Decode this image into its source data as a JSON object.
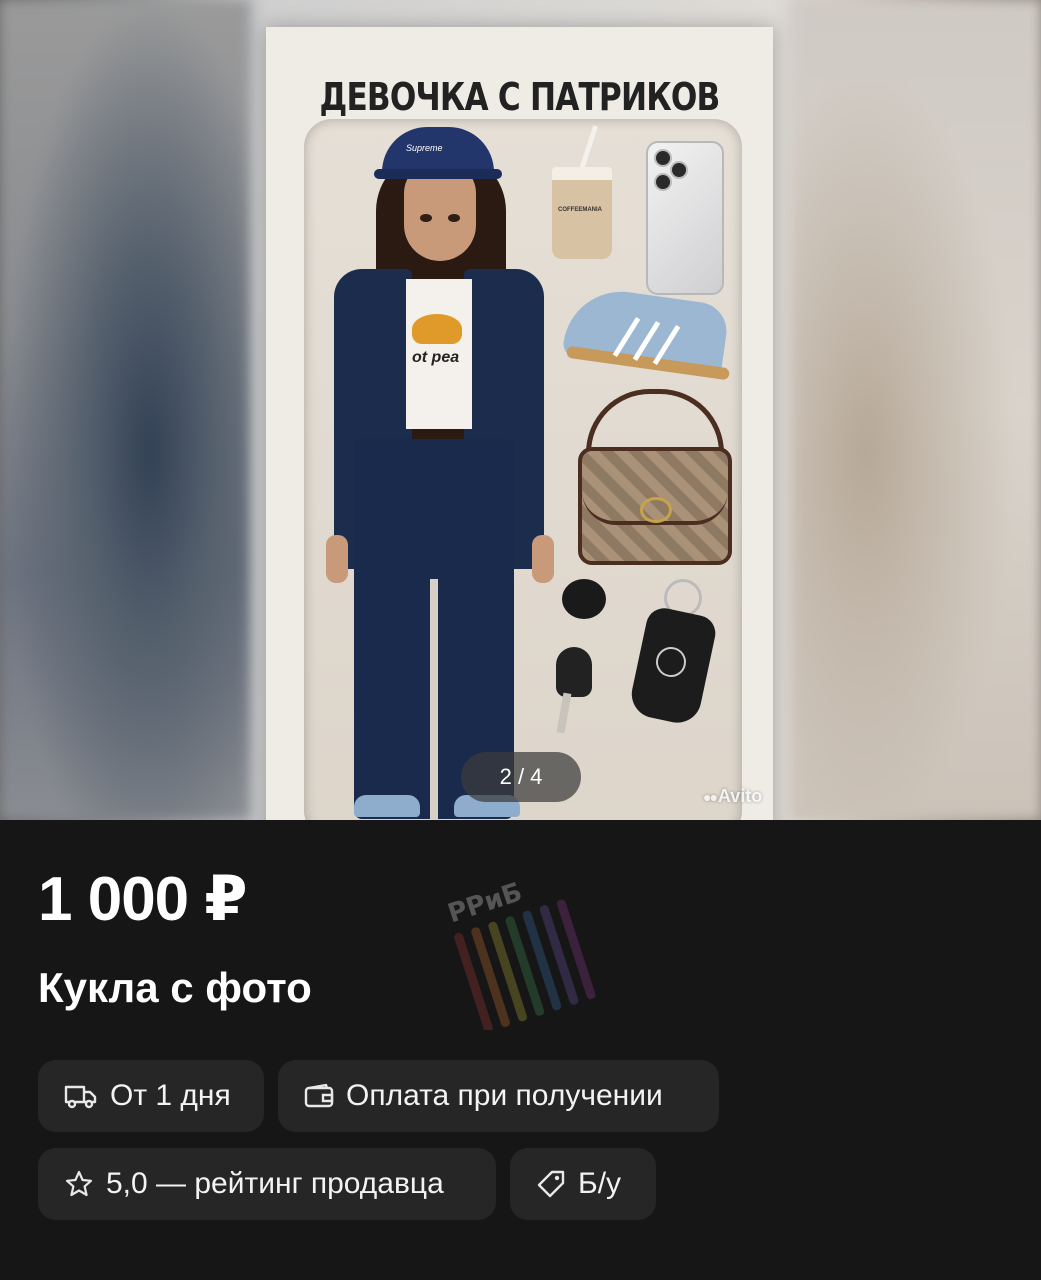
{
  "gallery": {
    "box_title": "ДЕВОЧКА С ПАТРИКОВ",
    "cap_text": "Supreme",
    "shirt_text": "ot pea",
    "cup_text": "COFFEEMANIA",
    "counter": "2 / 4",
    "watermark": "Avito"
  },
  "listing": {
    "price": "1 000 ₽",
    "title": "Кукла с фото"
  },
  "overlay_logo": "РРиБ",
  "chips": [
    {
      "label": "От 1 дня",
      "icon": "truck-icon"
    },
    {
      "label": "Оплата при получении",
      "icon": "wallet-icon"
    },
    {
      "label": "5,0 — рейтинг продавца",
      "icon": "star-icon"
    },
    {
      "label": "Б/у",
      "icon": "tag-icon"
    }
  ]
}
